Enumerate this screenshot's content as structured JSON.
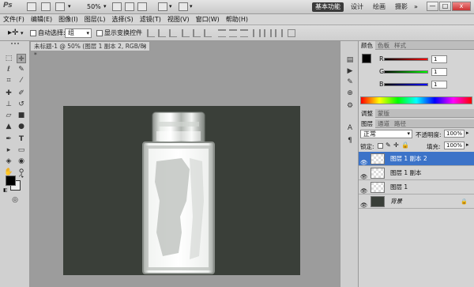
{
  "app": {
    "logo": "Ps"
  },
  "titlebar": {
    "zoom": "50%",
    "workspaces": [
      "基本功能",
      "设计",
      "绘画",
      "摄影"
    ],
    "overflow": "»",
    "window_buttons": {
      "minimize": "—",
      "restore": "□",
      "close": "x"
    }
  },
  "menu": [
    "文件(F)",
    "编辑(E)",
    "图像(I)",
    "图层(L)",
    "选择(S)",
    "滤镜(T)",
    "视图(V)",
    "窗口(W)",
    "帮助(H)"
  ],
  "options": {
    "auto_select_label": "自动选择:",
    "auto_select_value": "组",
    "show_transform_label": "显示变换控件"
  },
  "document": {
    "tab_title": "未标题-1 @ 50% (图层 1 副本 2, RGB/8) *",
    "tab_close": "×"
  },
  "color_panel": {
    "tabs": [
      "颜色",
      "色板",
      "样式"
    ],
    "channels": [
      {
        "label": "R",
        "value": "1"
      },
      {
        "label": "G",
        "value": "1"
      },
      {
        "label": "B",
        "value": "1"
      }
    ]
  },
  "adjust_tabs": [
    "调整",
    "蒙版"
  ],
  "layers_panel": {
    "tabs": [
      "图层",
      "通道",
      "路径"
    ],
    "blend_mode": "正常",
    "opacity_label": "不透明度:",
    "opacity_value": "100%",
    "lock_label": "锁定:",
    "fill_label": "填充:",
    "fill_value": "100%",
    "layers": [
      {
        "name": "图层 1 副本 2",
        "selected": true
      },
      {
        "name": "图层 1 副本",
        "selected": false
      },
      {
        "name": "图层 1",
        "selected": false
      },
      {
        "name": "背景",
        "selected": false
      }
    ]
  },
  "colors": {
    "canvas_bg": "#3a3f39",
    "selection": "#3c73c8",
    "workspace_bg": "#9c9c9c"
  }
}
